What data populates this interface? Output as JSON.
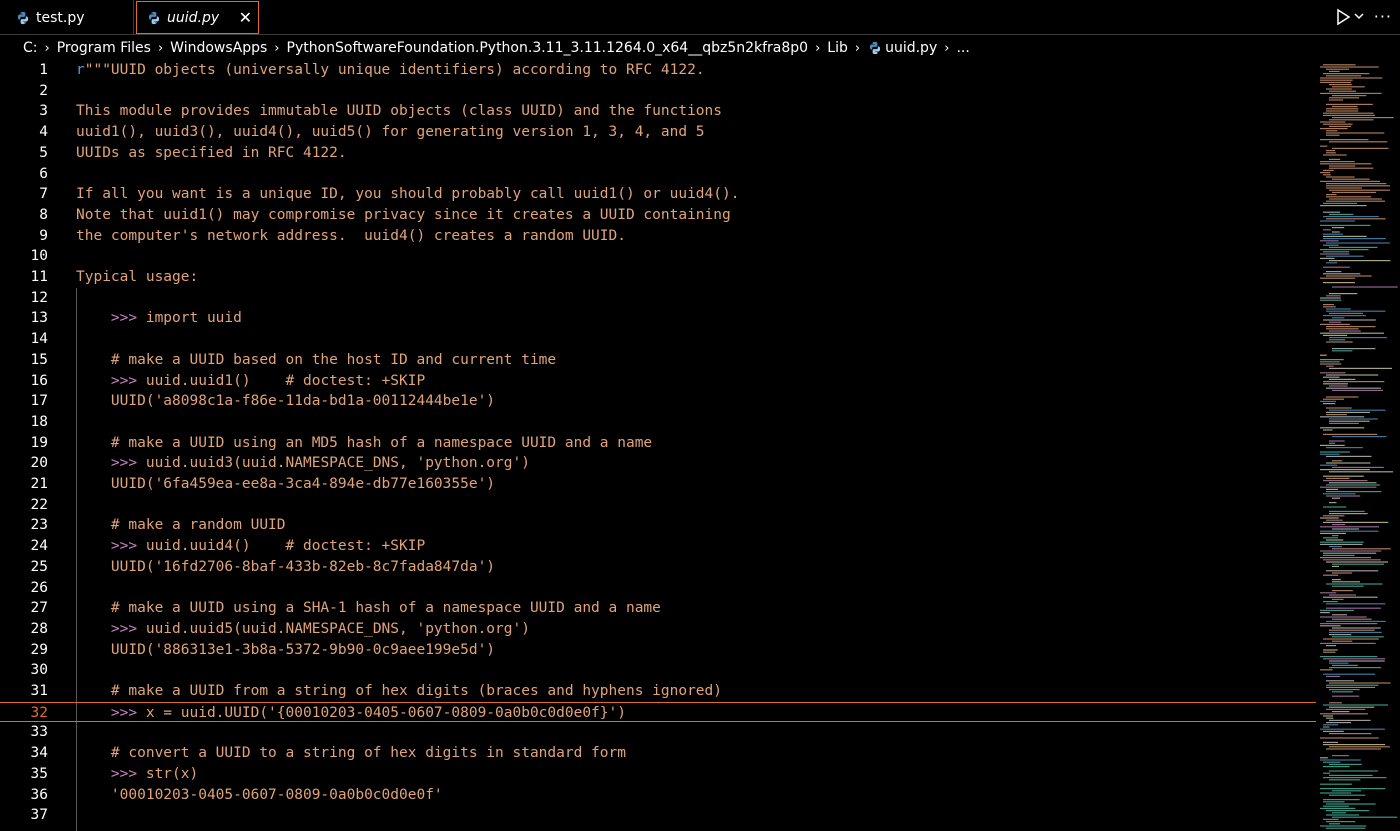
{
  "tabs": [
    {
      "label": "test.py",
      "active": false
    },
    {
      "label": "uuid.py",
      "active": true
    }
  ],
  "breadcrumb": [
    "C:",
    "Program Files",
    "WindowsApps",
    "PythonSoftwareFoundation.Python.3.11_3.11.1264.0_x64__qbz5n2kfra8p0",
    "Lib",
    "uuid.py",
    "..."
  ],
  "editor": {
    "current_line": 32,
    "lines": [
      {
        "n": "1",
        "pre": "r",
        "text": "\"\"\"UUID objects (universally unique identifiers) according to RFC 4122."
      },
      {
        "n": "2",
        "text": ""
      },
      {
        "n": "3",
        "text": "This module provides immutable UUID objects (class UUID) and the functions"
      },
      {
        "n": "4",
        "text": "uuid1(), uuid3(), uuid4(), uuid5() for generating version 1, 3, 4, and 5"
      },
      {
        "n": "5",
        "text": "UUIDs as specified in RFC 4122."
      },
      {
        "n": "6",
        "text": ""
      },
      {
        "n": "7",
        "text": "If all you want is a unique ID, you should probably call uuid1() or uuid4()."
      },
      {
        "n": "8",
        "text": "Note that uuid1() may compromise privacy since it creates a UUID containing"
      },
      {
        "n": "9",
        "text": "the computer's network address.  uuid4() creates a random UUID."
      },
      {
        "n": "10",
        "text": ""
      },
      {
        "n": "11",
        "text": "Typical usage:"
      },
      {
        "n": "12",
        "text": ""
      },
      {
        "n": "13",
        "prompt": "    >>> ",
        "text": "import uuid"
      },
      {
        "n": "14",
        "text": ""
      },
      {
        "n": "15",
        "text": "    # make a UUID based on the host ID and current time"
      },
      {
        "n": "16",
        "prompt": "    >>> ",
        "text": "uuid.uuid1()    # doctest: +SKIP"
      },
      {
        "n": "17",
        "text": "    UUID('a8098c1a-f86e-11da-bd1a-00112444be1e')"
      },
      {
        "n": "18",
        "text": ""
      },
      {
        "n": "19",
        "text": "    # make a UUID using an MD5 hash of a namespace UUID and a name"
      },
      {
        "n": "20",
        "prompt": "    >>> ",
        "text": "uuid.uuid3(uuid.NAMESPACE_DNS, 'python.org')"
      },
      {
        "n": "21",
        "text": "    UUID('6fa459ea-ee8a-3ca4-894e-db77e160355e')"
      },
      {
        "n": "22",
        "text": ""
      },
      {
        "n": "23",
        "text": "    # make a random UUID"
      },
      {
        "n": "24",
        "prompt": "    >>> ",
        "text": "uuid.uuid4()    # doctest: +SKIP"
      },
      {
        "n": "25",
        "text": "    UUID('16fd2706-8baf-433b-82eb-8c7fada847da')"
      },
      {
        "n": "26",
        "text": ""
      },
      {
        "n": "27",
        "text": "    # make a UUID using a SHA-1 hash of a namespace UUID and a name"
      },
      {
        "n": "28",
        "prompt": "    >>> ",
        "text": "uuid.uuid5(uuid.NAMESPACE_DNS, 'python.org')"
      },
      {
        "n": "29",
        "text": "    UUID('886313e1-3b8a-5372-9b90-0c9aee199e5d')"
      },
      {
        "n": "30",
        "text": ""
      },
      {
        "n": "31",
        "text": "    # make a UUID from a string of hex digits (braces and hyphens ignored)"
      },
      {
        "n": "32",
        "prompt": "    >>> ",
        "text": "x = uuid.UUID('{00010203-0405-0607-0809-0a0b0c0d0e0f}')"
      },
      {
        "n": "33",
        "text": ""
      },
      {
        "n": "34",
        "text": "    # convert a UUID to a string of hex digits in standard form"
      },
      {
        "n": "35",
        "prompt": "    >>> ",
        "text": "str(x)"
      },
      {
        "n": "36",
        "text": "    '00010203-0405-0607-0809-0a0b0c0d0e0f'"
      },
      {
        "n": "37",
        "text": ""
      }
    ]
  },
  "colors": {
    "background": "#000000",
    "string": "#e0a37a",
    "prompt": "#c586c0",
    "prefix": "#569cd6",
    "accent": "#e06c2c"
  }
}
